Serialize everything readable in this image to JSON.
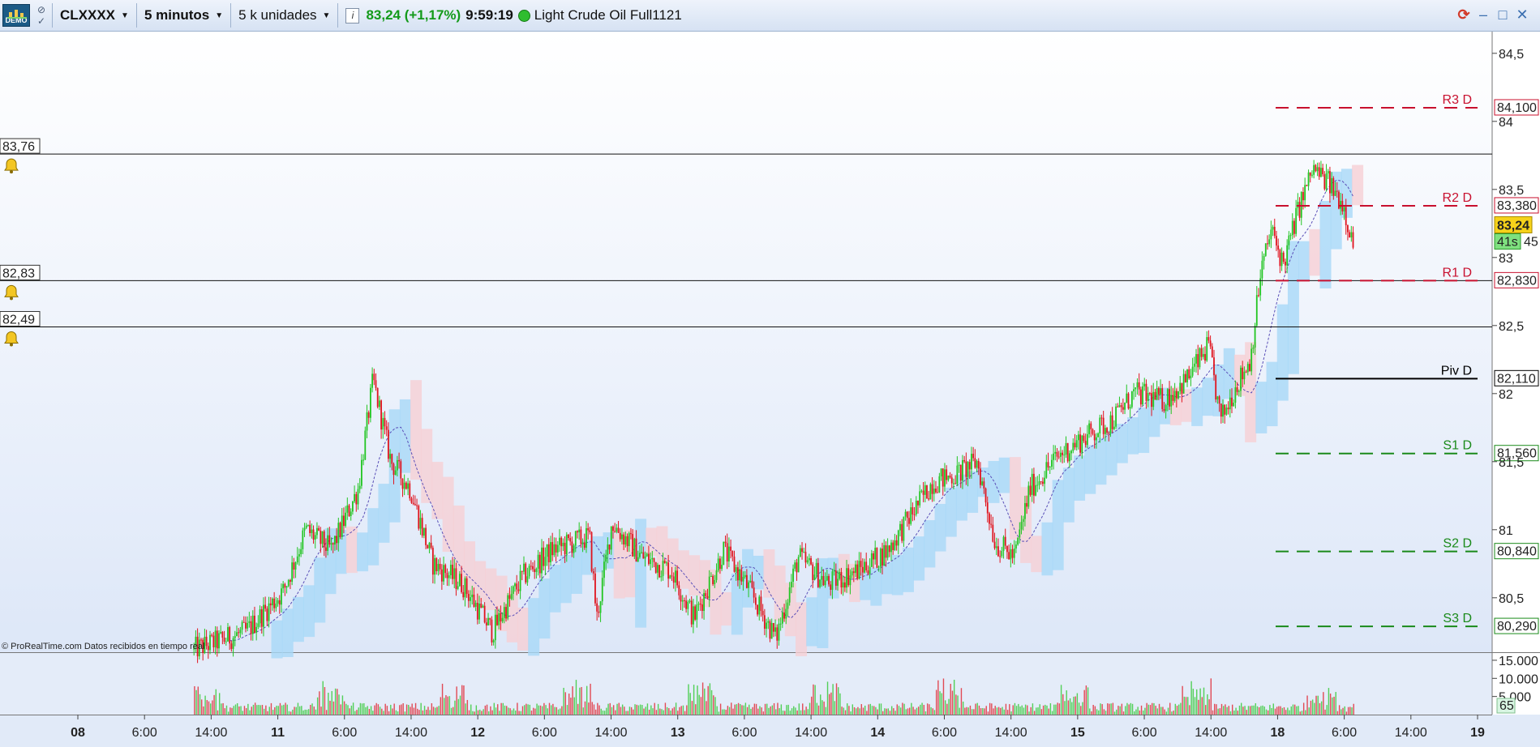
{
  "toolbar": {
    "demo_label": "DEMO",
    "ticker": "CLXXXX",
    "timeframe": "5 minutos",
    "units": "5 k unidades",
    "info_label": "i",
    "last_quote": "83,24 (+1,17%)",
    "time": "9:59:19",
    "instrument": "Light Crude Oil Full1121"
  },
  "chart_data": {
    "type": "candlestick",
    "credit": "© ProRealTime.com  Datos recibidos en tiempo real",
    "ylim": [
      80.1,
      84.6
    ],
    "y_ticks": [
      80.5,
      81,
      81.5,
      82,
      82.5,
      83,
      83.5,
      84,
      84.5
    ],
    "y_tick_labels": [
      "80,5",
      "81",
      "81,5",
      "82",
      "82,5",
      "83",
      "83,5",
      "84",
      "84,5"
    ],
    "x_ticks": [
      {
        "label": "08",
        "day": true
      },
      {
        "label": "6:00"
      },
      {
        "label": "14:00"
      },
      {
        "label": "11",
        "day": true
      },
      {
        "label": "6:00"
      },
      {
        "label": "14:00"
      },
      {
        "label": "12",
        "day": true
      },
      {
        "label": "6:00"
      },
      {
        "label": "14:00"
      },
      {
        "label": "13",
        "day": true
      },
      {
        "label": "6:00"
      },
      {
        "label": "14:00"
      },
      {
        "label": "14",
        "day": true
      },
      {
        "label": "6:00"
      },
      {
        "label": "14:00"
      },
      {
        "label": "15",
        "day": true
      },
      {
        "label": "6:00"
      },
      {
        "label": "14:00"
      },
      {
        "label": "18",
        "day": true
      },
      {
        "label": "6:00"
      },
      {
        "label": "14:00"
      },
      {
        "label": "19",
        "day": true
      }
    ],
    "price_path": [
      {
        "t": 0.13,
        "p": 80.12
      },
      {
        "t": 0.165,
        "p": 80.25
      },
      {
        "t": 0.19,
        "p": 80.55
      },
      {
        "t": 0.205,
        "p": 81.0
      },
      {
        "t": 0.222,
        "p": 80.85
      },
      {
        "t": 0.24,
        "p": 81.3
      },
      {
        "t": 0.25,
        "p": 82.1
      },
      {
        "t": 0.262,
        "p": 81.5
      },
      {
        "t": 0.275,
        "p": 81.3
      },
      {
        "t": 0.29,
        "p": 80.75
      },
      {
        "t": 0.31,
        "p": 80.6
      },
      {
        "t": 0.33,
        "p": 80.25
      },
      {
        "t": 0.35,
        "p": 80.65
      },
      {
        "t": 0.37,
        "p": 80.85
      },
      {
        "t": 0.395,
        "p": 80.95
      },
      {
        "t": 0.4,
        "p": 80.35
      },
      {
        "t": 0.41,
        "p": 81.05
      },
      {
        "t": 0.43,
        "p": 80.8
      },
      {
        "t": 0.45,
        "p": 80.7
      },
      {
        "t": 0.465,
        "p": 80.35
      },
      {
        "t": 0.485,
        "p": 80.85
      },
      {
        "t": 0.5,
        "p": 80.6
      },
      {
        "t": 0.52,
        "p": 80.2
      },
      {
        "t": 0.535,
        "p": 80.8
      },
      {
        "t": 0.555,
        "p": 80.6
      },
      {
        "t": 0.575,
        "p": 80.7
      },
      {
        "t": 0.595,
        "p": 80.85
      },
      {
        "t": 0.61,
        "p": 81.1
      },
      {
        "t": 0.625,
        "p": 81.35
      },
      {
        "t": 0.64,
        "p": 81.4
      },
      {
        "t": 0.655,
        "p": 81.5
      },
      {
        "t": 0.667,
        "p": 80.9
      },
      {
        "t": 0.68,
        "p": 80.8
      },
      {
        "t": 0.69,
        "p": 81.3
      },
      {
        "t": 0.71,
        "p": 81.55
      },
      {
        "t": 0.73,
        "p": 81.7
      },
      {
        "t": 0.745,
        "p": 81.8
      },
      {
        "t": 0.76,
        "p": 82.0
      },
      {
        "t": 0.78,
        "p": 81.95
      },
      {
        "t": 0.795,
        "p": 82.1
      },
      {
        "t": 0.81,
        "p": 82.35
      },
      {
        "t": 0.818,
        "p": 81.8
      },
      {
        "t": 0.828,
        "p": 82.05
      },
      {
        "t": 0.838,
        "p": 82.25
      },
      {
        "t": 0.845,
        "p": 82.9
      },
      {
        "t": 0.852,
        "p": 83.2
      },
      {
        "t": 0.86,
        "p": 82.95
      },
      {
        "t": 0.87,
        "p": 83.35
      },
      {
        "t": 0.88,
        "p": 83.65
      },
      {
        "t": 0.89,
        "p": 83.55
      },
      {
        "t": 0.9,
        "p": 83.4
      },
      {
        "t": 0.908,
        "p": 83.05
      }
    ],
    "levels": [
      {
        "name": "R3 D",
        "value": 84.1,
        "value_label": "84,100",
        "color": "#c8102e",
        "dash": true
      },
      {
        "name": "R2 D",
        "value": 83.38,
        "value_label": "83,380",
        "color": "#c8102e",
        "dash": true
      },
      {
        "name": "R1 D",
        "value": 82.83,
        "value_label": "82,830",
        "color": "#c8102e",
        "dash": true
      },
      {
        "name": "Piv D",
        "value": 82.11,
        "value_label": "82,110",
        "color": "#000000",
        "dash": false
      },
      {
        "name": "S1 D",
        "value": 81.56,
        "value_label": "81,560",
        "color": "#1a8a1a",
        "dash": true
      },
      {
        "name": "S2 D",
        "value": 80.84,
        "value_label": "80,840",
        "color": "#1a8a1a",
        "dash": true
      },
      {
        "name": "S3 D",
        "value": 80.29,
        "value_label": "80,290",
        "color": "#1a8a1a",
        "dash": true
      }
    ],
    "alerts": [
      {
        "value": 83.76,
        "label": "83,76"
      },
      {
        "value": 82.83,
        "label": "82,83"
      },
      {
        "value": 82.49,
        "label": "82,49"
      }
    ],
    "current_price": {
      "label": "83,24",
      "value": 83.24,
      "countdown": "41s",
      "extra": "45"
    },
    "volume": {
      "y_tick_labels": [
        "15.000",
        "10.000",
        "5.000"
      ],
      "y_ticks": [
        15000,
        10000,
        5000
      ],
      "current_label": "65"
    },
    "colors": {
      "up": "#22c522",
      "down": "#e0141e",
      "cloud_bull": "#a8d8f8",
      "cloud_bear": "#f6cfd4",
      "background": "#e6eefa"
    }
  }
}
